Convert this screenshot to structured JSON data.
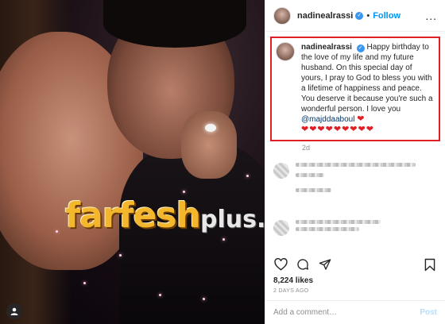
{
  "watermark": {
    "main": "farfesh",
    "sub": "plus.com"
  },
  "header": {
    "username": "nadinealrassi",
    "verified_icon": "verified-badge-icon",
    "separator": "•",
    "follow_label": "Follow",
    "more_icon": "more-options-icon",
    "more_label": "..."
  },
  "caption": {
    "username": "nadinealrassi",
    "text": "Happy birthday to the love of my life and my future husband. On this special day of yours, I pray to God to bless you with a lifetime of happiness and peace. You deserve it because you're such a wonderful person. I love you",
    "mention": "@majddaaboul",
    "heart_after_mention": "❤",
    "hearts": "❤❤❤❤❤❤❤❤❤",
    "time": "2d"
  },
  "actions": {
    "like_icon": "heart-icon",
    "comment_icon": "comment-icon",
    "share_icon": "share-icon",
    "save_icon": "bookmark-icon"
  },
  "likes": "8,224 likes",
  "post_date": "2 DAYS AGO",
  "comment_box": {
    "placeholder": "Add a comment…",
    "post_label": "Post"
  },
  "colors": {
    "accent": "#0095f6",
    "highlight_box": "#e01f25",
    "heart": "#e01f25"
  }
}
